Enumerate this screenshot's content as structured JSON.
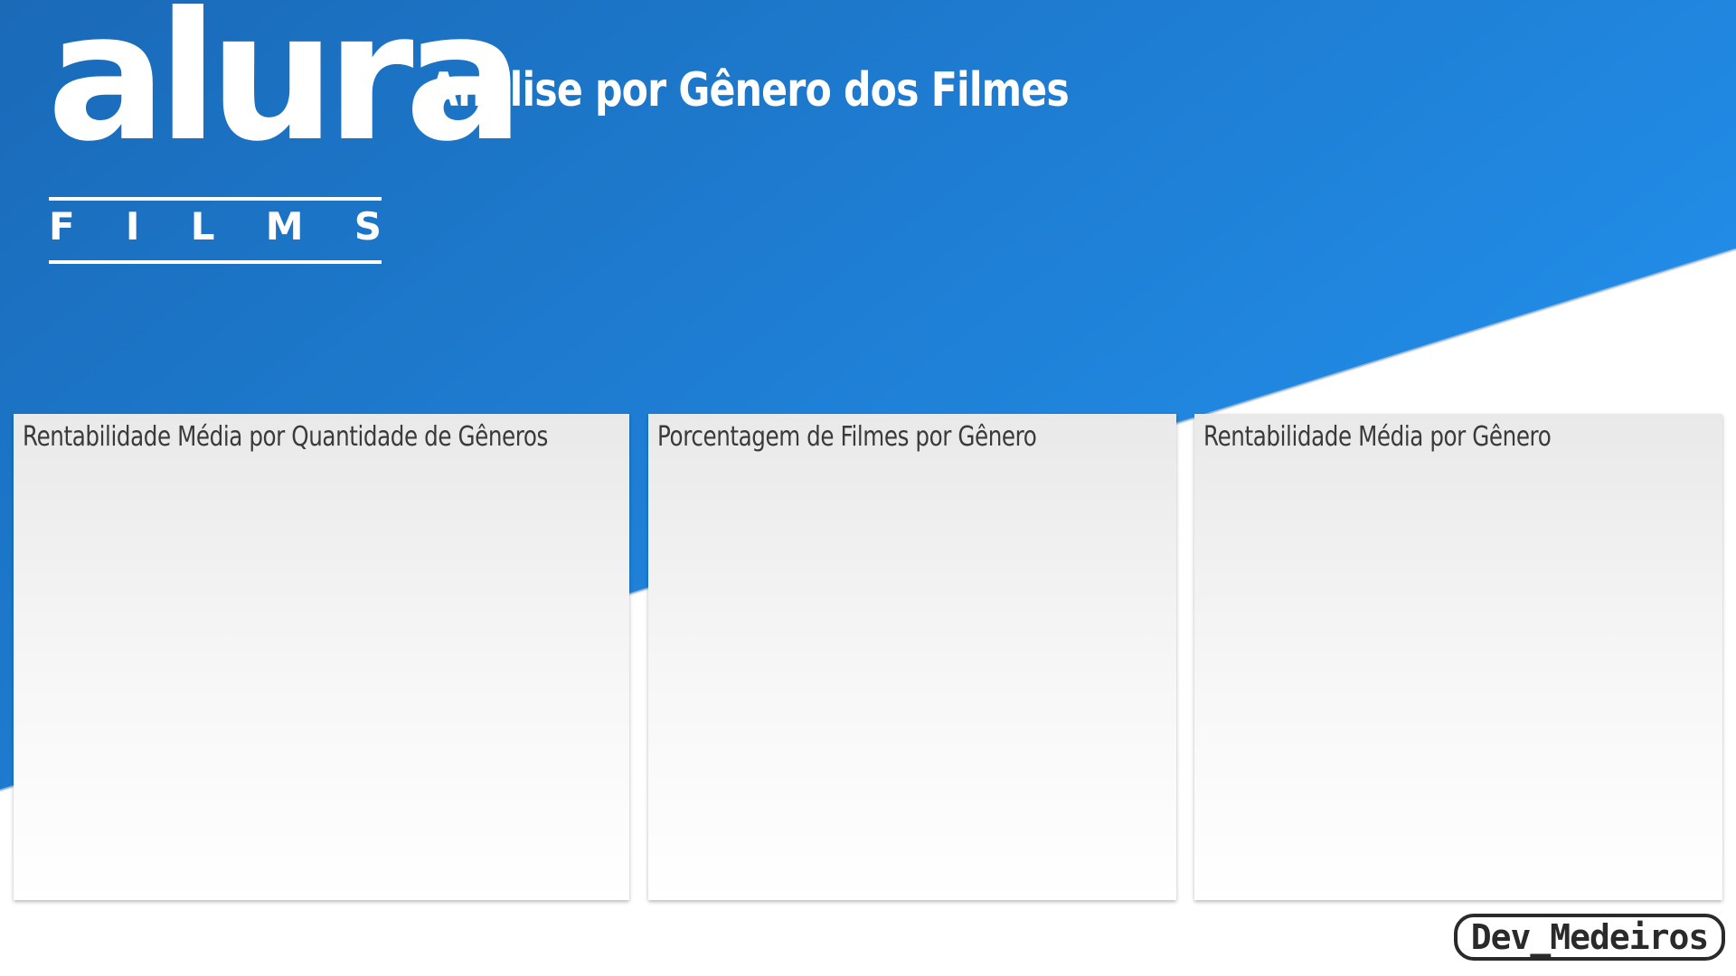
{
  "brand": {
    "logo_word": "alura",
    "logo_sub_letters": [
      "F",
      "I",
      "L",
      "M",
      "S"
    ]
  },
  "header": {
    "title": "Análise por Gênero dos Filmes"
  },
  "cards": [
    {
      "title": "Rentabilidade Média por Quantidade de Gêneros"
    },
    {
      "title": "Porcentagem de Filmes por Gênero"
    },
    {
      "title": "Rentabilidade Média por Gênero"
    }
  ],
  "footer": {
    "badge": "Dev_Medeiros"
  },
  "colors": {
    "primary_blue_dark": "#1a6ab8",
    "primary_blue_light": "#2088e6",
    "background": "#ffffff",
    "card_top": "#e9e9e9",
    "card_title_text": "#3a3a3a"
  }
}
